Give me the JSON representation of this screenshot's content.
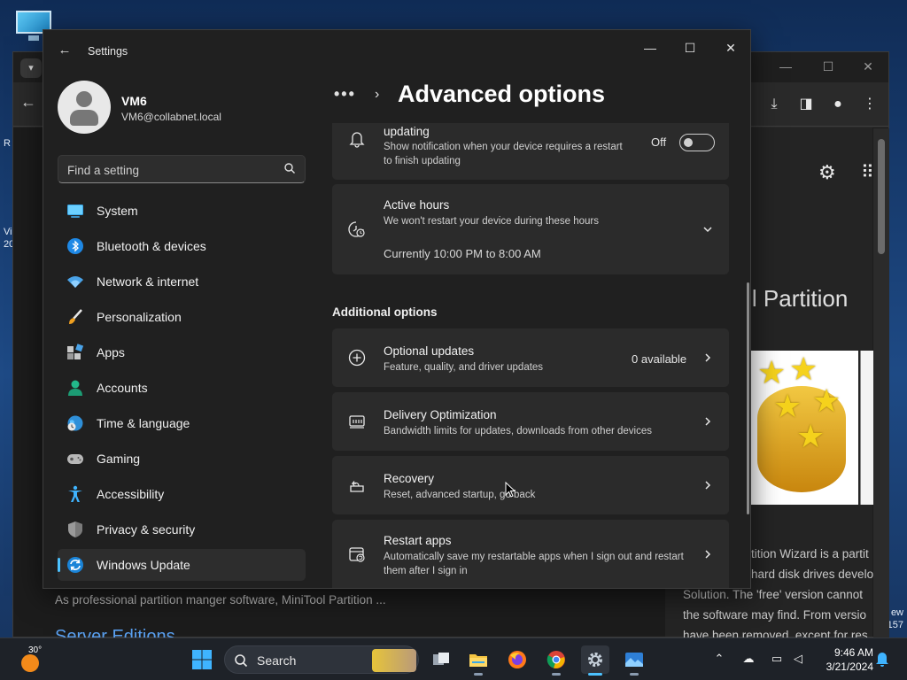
{
  "desktop": {
    "left_edge_texts": [
      "R",
      "Vi",
      "20"
    ],
    "right_edge_texts": [
      "ew",
      "157"
    ]
  },
  "browser": {
    "window_controls": [
      "—",
      "☐",
      "✕"
    ],
    "heading_partial": "ool Partition",
    "description_lines": [
      "tition Wizard is a partit",
      "hard disk drives develo",
      "Solution. The 'free' version cannot",
      "the software may find. From versio",
      "have been removed, except for res"
    ],
    "left_text": "As professional partition manger software, MiniTool Partition ...",
    "server_heading": "Server Editions"
  },
  "settings": {
    "title": "Settings",
    "window_controls": {
      "minimize": "—",
      "maximize": "☐",
      "close": "✕"
    },
    "user": {
      "name": "VM6",
      "email": "VM6@collabnet.local"
    },
    "search": {
      "placeholder": "Find a setting"
    },
    "nav": [
      {
        "label": "System",
        "icon": "system-icon"
      },
      {
        "label": "Bluetooth & devices",
        "icon": "bluetooth-icon"
      },
      {
        "label": "Network & internet",
        "icon": "wifi-icon"
      },
      {
        "label": "Personalization",
        "icon": "brush-icon"
      },
      {
        "label": "Apps",
        "icon": "apps-icon"
      },
      {
        "label": "Accounts",
        "icon": "accounts-icon"
      },
      {
        "label": "Time & language",
        "icon": "globe-clock-icon"
      },
      {
        "label": "Gaming",
        "icon": "gamepad-icon"
      },
      {
        "label": "Accessibility",
        "icon": "accessibility-icon"
      },
      {
        "label": "Privacy & security",
        "icon": "shield-icon"
      },
      {
        "label": "Windows Update",
        "icon": "update-icon",
        "active": true
      }
    ],
    "breadcrumb": {
      "dots": "•••",
      "separator": "›"
    },
    "page_title": "Advanced options",
    "notify_card": {
      "title": "updating",
      "subtitle": "Show notification when your device requires a restart to finish updating",
      "toggle_label": "Off",
      "toggle_on": false
    },
    "active_hours": {
      "title": "Active hours",
      "subtitle": "We won't restart your device during these hours",
      "current": "Currently 10:00 PM to 8:00 AM"
    },
    "additional_options_label": "Additional options",
    "options": [
      {
        "title": "Optional updates",
        "subtitle": "Feature, quality, and driver updates",
        "value": "0 available",
        "icon": "plus-circle-icon"
      },
      {
        "title": "Delivery Optimization",
        "subtitle": "Bandwidth limits for updates, downloads from other devices",
        "value": "",
        "icon": "delivery-icon"
      },
      {
        "title": "Recovery",
        "subtitle": "Reset, advanced startup, go back",
        "value": "",
        "icon": "recovery-icon"
      },
      {
        "title": "Restart apps",
        "subtitle": "Automatically save my restartable apps when I sign out and restart them after I sign in",
        "value": "",
        "icon": "restart-apps-icon"
      }
    ]
  },
  "taskbar": {
    "weather_temp": "30°",
    "search_label": "Search",
    "clock_time": "9:46 AM",
    "clock_date": "3/21/2024",
    "apps": [
      "task-view",
      "file-explorer",
      "firefox",
      "chrome",
      "settings",
      "photos"
    ]
  },
  "colors": {
    "accent": "#4cc2ff",
    "window_bg": "#202020",
    "card_bg": "#2b2b2b"
  }
}
